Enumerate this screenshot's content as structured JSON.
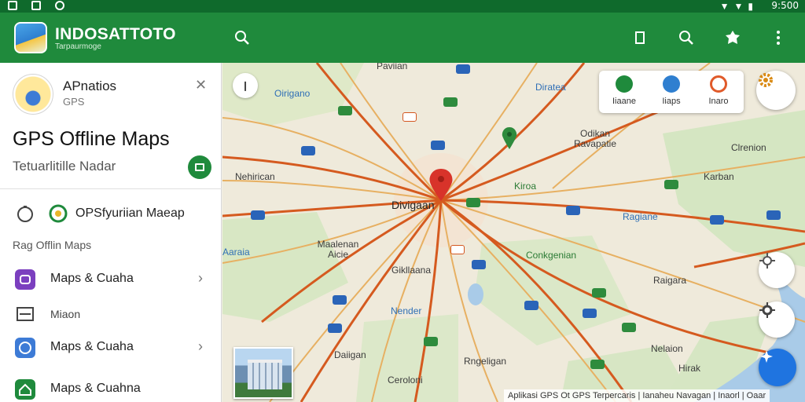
{
  "status_bar": {
    "time": "9:500"
  },
  "app_bar": {
    "title": "INDOSATTOTO",
    "subtitle": "Tarpaurmoge",
    "icons": [
      "search-icon",
      "bookmark-icon",
      "search-icon",
      "puzzle-icon",
      "more-vert-icon"
    ]
  },
  "sidebar": {
    "account_title": "APnatios",
    "account_sub": "GPS",
    "heading": "GPS Offline Maps",
    "subheading": "Tetuarlitille Nadar",
    "items": [
      {
        "label": "OPSfyuriian Maeap",
        "icon": "navigation-icon"
      },
      {
        "label": "Maps & Cuaha",
        "icon": "chat-icon",
        "icon_color": "#7b3fbf"
      },
      {
        "label": "Miaon",
        "icon": "inbox-icon"
      },
      {
        "label": "Maps & Cuaha",
        "icon": "compass-icon",
        "icon_color": "#3d7bd6"
      },
      {
        "label": "Maps & Cuahna",
        "icon": "house-icon",
        "icon_color": "#1f8a3c"
      }
    ],
    "section_label": "Rag Offlin Maps"
  },
  "map": {
    "layers": [
      {
        "label": "Iiaane",
        "color": "#1f8a3c"
      },
      {
        "label": "Iiaps",
        "color": "#2f7fd0"
      },
      {
        "label": "Inaro",
        "color": "#e05a2a"
      }
    ],
    "places": [
      {
        "name": "Paviian"
      },
      {
        "name": "Oirigano"
      },
      {
        "name": "Diratea"
      },
      {
        "name": "Odikan Ravapatie"
      },
      {
        "name": "Clrenion"
      },
      {
        "name": "Nehirican"
      },
      {
        "name": "Divigaan"
      },
      {
        "name": "Kiroa"
      },
      {
        "name": "Karban"
      },
      {
        "name": "Ragiane"
      },
      {
        "name": "Maalenan Aicie"
      },
      {
        "name": "Conkgenian"
      },
      {
        "name": "Gikllaana"
      },
      {
        "name": "Raigara"
      },
      {
        "name": "Nender"
      },
      {
        "name": "Daiigan"
      },
      {
        "name": "Rngeligan"
      },
      {
        "name": "Nelaion"
      },
      {
        "name": "Hirak"
      },
      {
        "name": "Ceroloni"
      },
      {
        "name": "Aaraia"
      }
    ],
    "attribution": "Aplikasi GPS Ot GPS Terpercaris | Ianaheu Navagan | Inaorl | Oaar"
  },
  "colors": {
    "brand": "#1f8a3c",
    "statusbar": "#0f6a2c",
    "accent": "#1f74e0",
    "road": "#d55a1f"
  }
}
